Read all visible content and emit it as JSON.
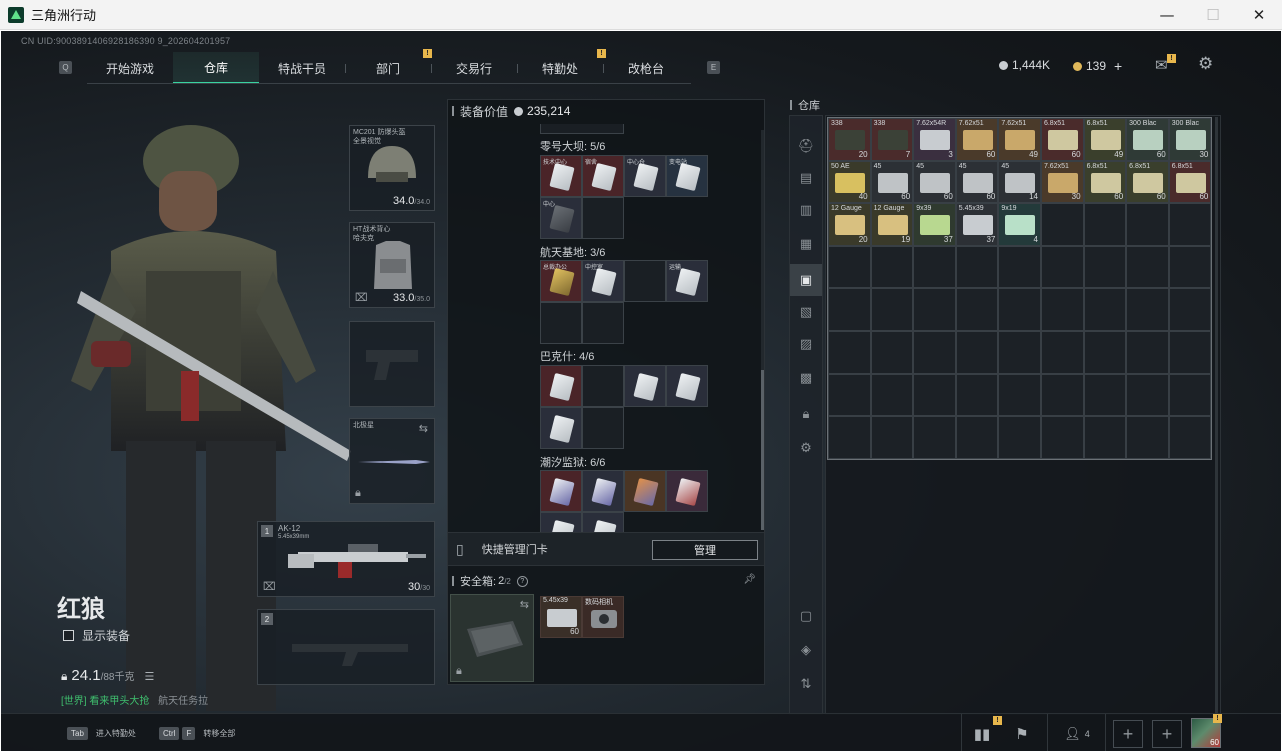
{
  "window": {
    "title": "三角洲行动",
    "controls": [
      "—",
      "☐",
      "✕"
    ]
  },
  "uid": "CN UID:9003891406928186390 9_202604201957",
  "nav": {
    "key_left": "Q",
    "key_right": "E",
    "tabs": [
      {
        "label": "开始游戏",
        "active": false,
        "badge": false
      },
      {
        "label": "仓库",
        "active": true,
        "badge": false
      },
      {
        "label": "特战干员",
        "active": false,
        "badge": false
      },
      {
        "label": "部门",
        "active": false,
        "badge": true
      },
      {
        "label": "交易行",
        "active": false,
        "badge": false
      },
      {
        "label": "特勤处",
        "active": false,
        "badge": true
      },
      {
        "label": "改枪台",
        "active": false,
        "badge": false
      }
    ],
    "badge_text": "!"
  },
  "currency": {
    "silver": "1,444K",
    "gold": "139",
    "gold_plus": "+"
  },
  "colors": {
    "accent": "#39d3a0",
    "badge": "#e8b74c",
    "chat_green": "#3fbf6e"
  },
  "character": {
    "name": "红狼",
    "show_equipment": "显示装备",
    "weight_current": "24.1",
    "weight_max": "/88千克",
    "chat_channel": "[世界] 看来甲头大抢",
    "chat_msg": "航天任务拉"
  },
  "equipment": {
    "helmet": {
      "label": "MC201 防爆头盔\n全景视觉",
      "value": "34.0",
      "max": "/34.0"
    },
    "armor": {
      "label": "HT战术背心\n哈夫克",
      "value": "33.0",
      "max": "/35.0"
    },
    "melee": {
      "label": "北极星"
    },
    "weapon1": {
      "num": "1",
      "name": "AK-12",
      "caliber": "5.45x39mm",
      "ammo": "30",
      "ammo_max": "/30"
    },
    "weapon2": {
      "num": "2"
    }
  },
  "center": {
    "header_label": "装备价值",
    "header_value": "235,214",
    "groups": [
      {
        "title": "零号大坝: 5/6"
      },
      {
        "title": "航天基地: 3/6"
      },
      {
        "title": "巴克什: 4/6"
      },
      {
        "title": "潮汐监狱: 6/6"
      }
    ],
    "card_tags": [
      "技术中心",
      "宿舍",
      "中心仓",
      "变电站",
      "中心",
      "总裁办公",
      "中控室",
      "运输"
    ],
    "quick_label": "快捷管理门卡",
    "manage_button": "管理",
    "safe_label": "安全箱:",
    "safe_count": "2",
    "safe_count_max": "/2",
    "safe_items": [
      {
        "label": "5.45x39",
        "count": "60"
      },
      {
        "label": "数码相机",
        "count": ""
      }
    ]
  },
  "warehouse": {
    "title": "仓库",
    "items": [
      {
        "label": "338",
        "count": "20",
        "bg": "#4a2b2b",
        "box": "#3b4137"
      },
      {
        "label": "338",
        "count": "7",
        "bg": "#4a2b2b",
        "box": "#3b4137"
      },
      {
        "label": "7.62x54R",
        "count": "3",
        "bg": "#3a2f3f",
        "box": "#c8ccd0"
      },
      {
        "label": "7.62x51",
        "count": "60",
        "bg": "#4a3a2a",
        "box": "#c9a86a"
      },
      {
        "label": "7.62x51",
        "count": "49",
        "bg": "#4a3a2a",
        "box": "#c9a86a"
      },
      {
        "label": "6.8x51",
        "count": "60",
        "bg": "#4a2b2b",
        "box": "#cfc8a0"
      },
      {
        "label": "6.8x51",
        "count": "49",
        "bg": "#3a3f2c",
        "box": "#cfc8a0"
      },
      {
        "label": "300 Blac",
        "count": "60",
        "bg": "#2f3a36",
        "box": "#b8d0c0"
      },
      {
        "label": "300 Blac",
        "count": "30",
        "bg": "#2f3a36",
        "box": "#b8d0c0"
      },
      {
        "label": "50 AE",
        "count": "40",
        "bg": "#3a3a2a",
        "box": "#d8c060"
      },
      {
        "label": "45",
        "count": "60",
        "bg": "#2c3035",
        "box": "#bfc3c6"
      },
      {
        "label": "45",
        "count": "60",
        "bg": "#2c3035",
        "box": "#bfc3c6"
      },
      {
        "label": "45",
        "count": "60",
        "bg": "#2c3035",
        "box": "#bfc3c6"
      },
      {
        "label": "45",
        "count": "14",
        "bg": "#2c3035",
        "box": "#bfc3c6"
      },
      {
        "label": "7.62x51",
        "count": "30",
        "bg": "#4a3a2a",
        "box": "#c9a86a"
      },
      {
        "label": "6.8x51",
        "count": "60",
        "bg": "#3a3f2c",
        "box": "#cfc8a0"
      },
      {
        "label": "6.8x51",
        "count": "60",
        "bg": "#3a3f2c",
        "box": "#cfc8a0"
      },
      {
        "label": "6.8x51",
        "count": "60",
        "bg": "#4a2b2b",
        "box": "#cfc8a0"
      },
      {
        "label": "12 Gauge",
        "count": "20",
        "bg": "#3a3a2a",
        "box": "#d8c080"
      },
      {
        "label": "12 Gauge",
        "count": "19",
        "bg": "#3a3a2a",
        "box": "#d8c080"
      },
      {
        "label": "9x39",
        "count": "37",
        "bg": "#2f3a2f",
        "box": "#b8d890"
      },
      {
        "label": "5.45x39",
        "count": "37",
        "bg": "#2c3035",
        "box": "#c8ccd0"
      },
      {
        "label": "9x19",
        "count": "4",
        "bg": "#233a3a",
        "box": "#b8e0c8"
      }
    ],
    "sidebar_icons": [
      "helmet-icon",
      "ammo-icon",
      "armor-icon",
      "weapon-icon",
      "ammo-box-icon",
      "attachment-icon",
      "medical-icon",
      "key-icon",
      "lock-icon",
      "settings-icon",
      "id-icon",
      "layers-icon",
      "sort-icon"
    ]
  },
  "bottom": {
    "hint1_key": "Tab",
    "hint1_label": "进入特勤处",
    "hint2_key1": "Ctrl",
    "hint2_key2": "F",
    "hint2_label": "转移全部",
    "friends_count": "4",
    "avatar_level": "60"
  }
}
